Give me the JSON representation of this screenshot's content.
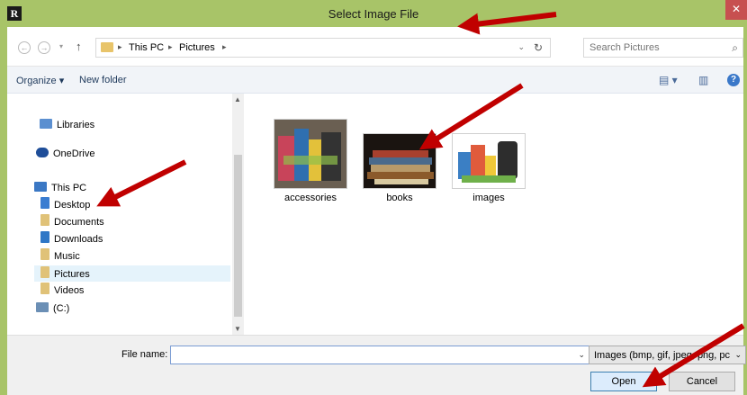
{
  "window": {
    "title": "Select Image File",
    "app_icon_letter": "R",
    "close_glyph": "✕"
  },
  "address": {
    "back_glyph": "←",
    "forward_glyph": "→",
    "dropdown_glyph": "▾",
    "up_glyph": "↑",
    "separator_glyph": "▸",
    "crumbs": [
      "This PC",
      "Pictures"
    ],
    "dropdown_chevron": "⌄",
    "refresh_glyph": "↻"
  },
  "search": {
    "placeholder": "Search Pictures",
    "icon_glyph": "⌕"
  },
  "toolbar": {
    "organize_label": "Organize ▾",
    "new_folder_label": "New folder",
    "view_glyph": "▤ ▾",
    "pane_glyph": "▥",
    "help_glyph": "?"
  },
  "nav_pane": {
    "items": [
      {
        "label": "Libraries",
        "icon": "libraries-icon",
        "color": "#5b8fd0"
      },
      {
        "label": "OneDrive",
        "icon": "cloud-icon",
        "color": "#1f4e99"
      },
      {
        "label": "This PC",
        "icon": "computer-icon",
        "color": "#3b78c4"
      },
      {
        "label": "Desktop",
        "icon": "desktop-folder-icon",
        "color": "#3a7dd1"
      },
      {
        "label": "Documents",
        "icon": "documents-folder-icon",
        "color": "#e0c278"
      },
      {
        "label": "Downloads",
        "icon": "downloads-folder-icon",
        "color": "#2f77c6"
      },
      {
        "label": "Music",
        "icon": "music-folder-icon",
        "color": "#e0c278"
      },
      {
        "label": "Pictures",
        "icon": "pictures-folder-icon",
        "color": "#e0c278"
      },
      {
        "label": "Videos",
        "icon": "videos-folder-icon",
        "color": "#e0c278"
      },
      {
        "label": "(C:)",
        "icon": "drive-icon",
        "color": "#6b8fb5"
      }
    ],
    "selected": "Pictures"
  },
  "files": [
    {
      "label": "accessories",
      "icon": "accessories-thumbnail"
    },
    {
      "label": "books",
      "icon": "books-thumbnail"
    },
    {
      "label": "images",
      "icon": "images-thumbnail"
    }
  ],
  "bottom": {
    "file_name_label": "File name:",
    "file_name_value": "",
    "filter_value": "Images (bmp, gif, jpeg, png, pc",
    "open_label": "Open",
    "cancel_label": "Cancel"
  },
  "colors": {
    "titlebar": "#a8c468",
    "annotation_arrow": "#c00000",
    "selected_item": "#e5f3fb"
  }
}
